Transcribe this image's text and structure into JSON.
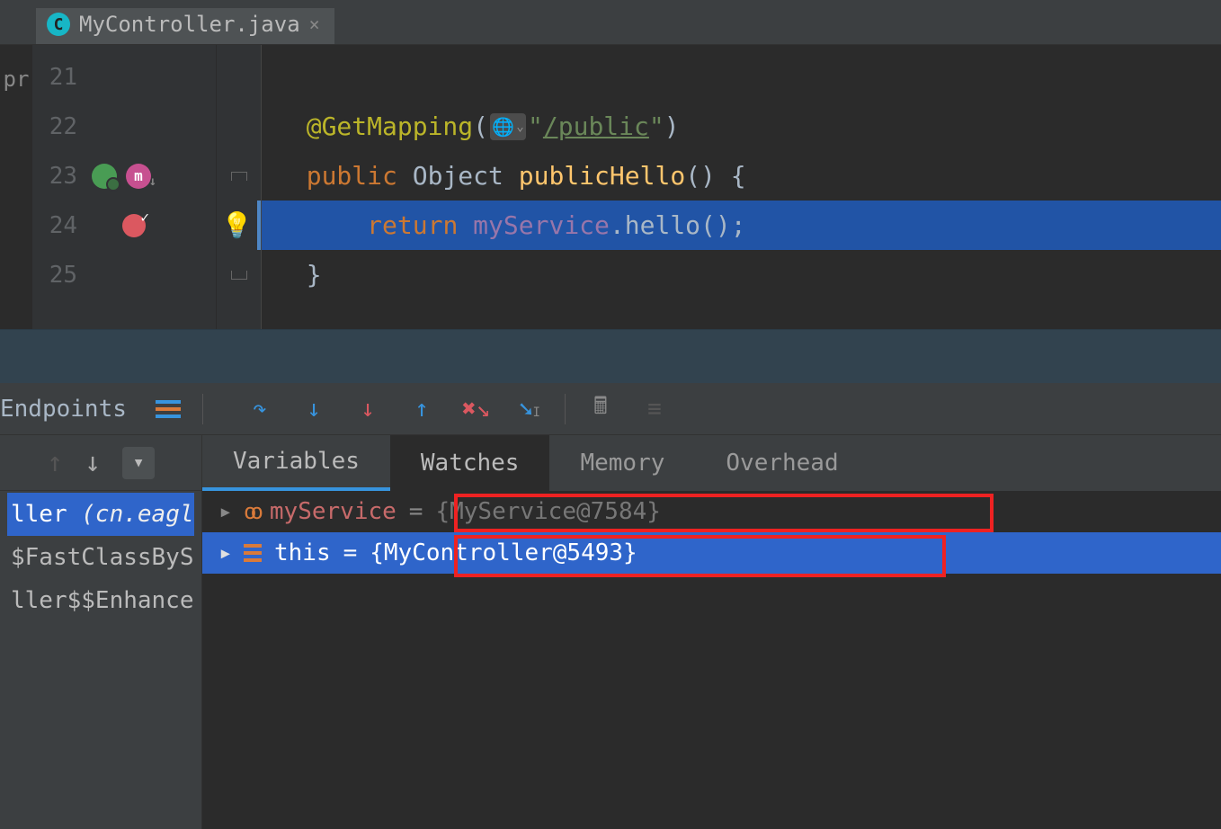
{
  "tab": {
    "filename": "MyController.java",
    "icon_letter": "C"
  },
  "project_stub": "pr",
  "editor": {
    "lines": {
      "l21_num": "21",
      "l22_num": "22",
      "l23_num": "23",
      "l24_num": "24",
      "l25_num": "25"
    },
    "code": {
      "annotation": "@GetMapping",
      "lparen": "(",
      "quote1": "\"",
      "path": "/public",
      "quote2": "\"",
      "rparen": ")",
      "kw_public": "public",
      "type_object": "Object",
      "method_name": "publicHello",
      "paren_open": "()",
      "brace_open": " {",
      "kw_return": "return",
      "field": "myService",
      "dot": ".",
      "call": "hello",
      "call_paren": "();",
      "brace_close": "}"
    }
  },
  "debug_toolbar": {
    "endpoints": "Endpoints"
  },
  "debug_tabs": {
    "variables": "Variables",
    "watches": "Watches",
    "memory": "Memory",
    "overhead": "Overhead"
  },
  "frames": {
    "row1_a": "ller ",
    "row1_b": "(cn.eagl",
    "row2": "$FastClassByS",
    "row3": "ller$$Enhance"
  },
  "vars": {
    "watch_name": "myService",
    "watch_eq": " = ",
    "watch_val": "{MyService@7584}",
    "this_name": "this",
    "this_eq": " = ",
    "this_val": "{MyController@5493}"
  }
}
